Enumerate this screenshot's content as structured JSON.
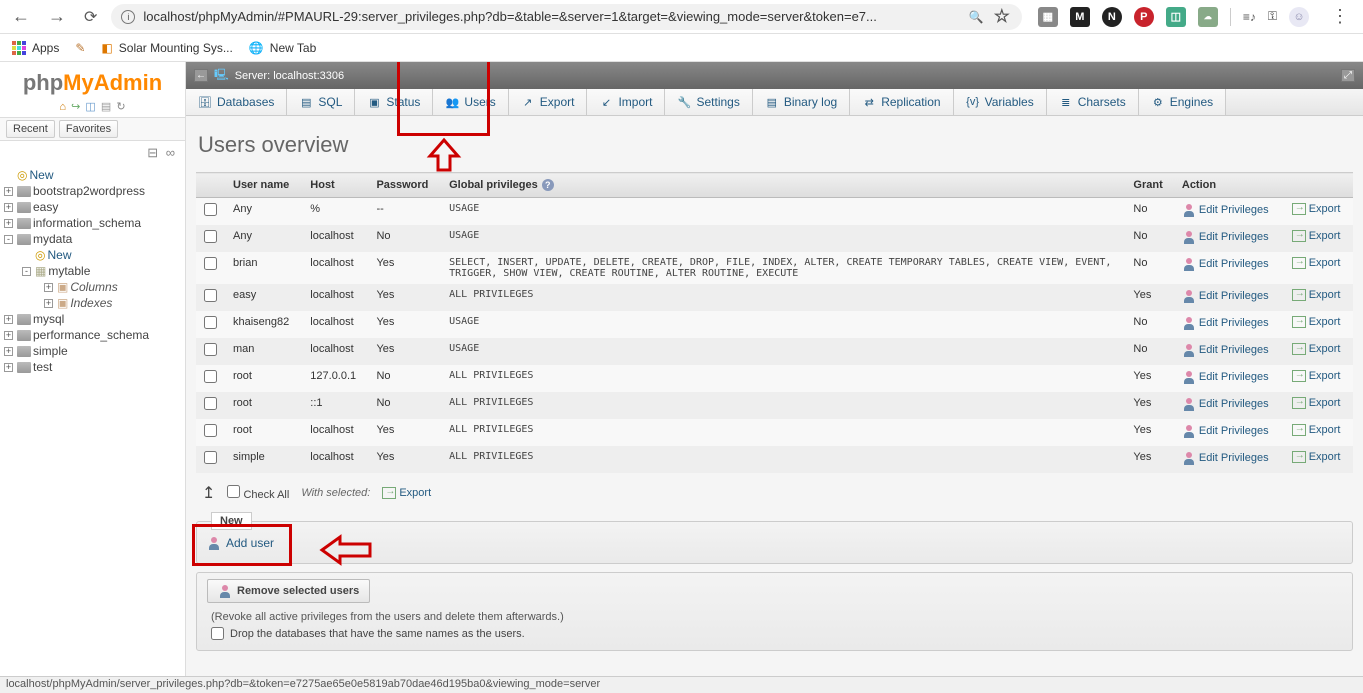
{
  "browser": {
    "url": "localhost/phpMyAdmin/#PMAURL-29:server_privileges.php?db=&table=&server=1&target=&viewing_mode=server&token=e7...",
    "bookmarks": {
      "apps": "Apps",
      "solar": "Solar Mounting Sys...",
      "newtab": "New Tab"
    }
  },
  "logo": {
    "php": "php",
    "my": "My",
    "admin": "Admin"
  },
  "sidebar": {
    "recent": "Recent",
    "favorites": "Favorites",
    "tree": [
      {
        "label": "New",
        "type": "new",
        "depth": 0
      },
      {
        "label": "bootstrap2wordpress",
        "type": "db",
        "depth": 0,
        "exp": "+"
      },
      {
        "label": "easy",
        "type": "db",
        "depth": 0,
        "exp": "+"
      },
      {
        "label": "information_schema",
        "type": "db",
        "depth": 0,
        "exp": "+"
      },
      {
        "label": "mydata",
        "type": "db",
        "depth": 0,
        "exp": "-"
      },
      {
        "label": "New",
        "type": "new",
        "depth": 1
      },
      {
        "label": "mytable",
        "type": "table",
        "depth": 1,
        "exp": "-"
      },
      {
        "label": "Columns",
        "type": "cols",
        "depth": 2,
        "exp": "+",
        "italic": true
      },
      {
        "label": "Indexes",
        "type": "idx",
        "depth": 2,
        "exp": "+",
        "italic": true
      },
      {
        "label": "mysql",
        "type": "db",
        "depth": 0,
        "exp": "+"
      },
      {
        "label": "performance_schema",
        "type": "db",
        "depth": 0,
        "exp": "+"
      },
      {
        "label": "simple",
        "type": "db",
        "depth": 0,
        "exp": "+"
      },
      {
        "label": "test",
        "type": "db",
        "depth": 0,
        "exp": "+"
      }
    ]
  },
  "server_bar": "Server: localhost:3306",
  "tabs": [
    {
      "label": "Databases",
      "icon": "🗄"
    },
    {
      "label": "SQL",
      "icon": "▤"
    },
    {
      "label": "Status",
      "icon": "▣"
    },
    {
      "label": "Users",
      "icon": "👥"
    },
    {
      "label": "Export",
      "icon": "↗"
    },
    {
      "label": "Import",
      "icon": "↙"
    },
    {
      "label": "Settings",
      "icon": "🔧"
    },
    {
      "label": "Binary log",
      "icon": "▤"
    },
    {
      "label": "Replication",
      "icon": "⇄"
    },
    {
      "label": "Variables",
      "icon": "{v}"
    },
    {
      "label": "Charsets",
      "icon": "≣"
    },
    {
      "label": "Engines",
      "icon": "⚙"
    }
  ],
  "page_title": "Users overview",
  "headers": {
    "user": "User name",
    "host": "Host",
    "password": "Password",
    "globalpriv": "Global privileges",
    "grant": "Grant",
    "action": "Action"
  },
  "edit_label": "Edit Privileges",
  "export_label": "Export",
  "users": [
    {
      "user": "Any",
      "user_red": true,
      "host": "%",
      "password": "--",
      "priv": "USAGE",
      "grant": "No"
    },
    {
      "user": "Any",
      "user_red": true,
      "host": "localhost",
      "password": "No",
      "pw_red": true,
      "priv": "USAGE",
      "grant": "No"
    },
    {
      "user": "brian",
      "host": "localhost",
      "password": "Yes",
      "priv": "SELECT, INSERT, UPDATE, DELETE, CREATE, DROP, FILE, INDEX, ALTER, CREATE TEMPORARY TABLES, CREATE VIEW, EVENT, TRIGGER, SHOW VIEW, CREATE ROUTINE, ALTER ROUTINE, EXECUTE",
      "grant": "No"
    },
    {
      "user": "easy",
      "host": "localhost",
      "password": "Yes",
      "priv": "ALL PRIVILEGES",
      "grant": "Yes"
    },
    {
      "user": "khaiseng82",
      "host": "localhost",
      "password": "Yes",
      "priv": "USAGE",
      "grant": "No"
    },
    {
      "user": "man",
      "host": "localhost",
      "password": "Yes",
      "priv": "USAGE",
      "grant": "No"
    },
    {
      "user": "root",
      "host": "127.0.0.1",
      "password": "No",
      "pw_red": true,
      "priv": "ALL PRIVILEGES",
      "grant": "Yes"
    },
    {
      "user": "root",
      "host": "::1",
      "password": "No",
      "pw_red": true,
      "priv": "ALL PRIVILEGES",
      "grant": "Yes"
    },
    {
      "user": "root",
      "host": "localhost",
      "password": "Yes",
      "priv": "ALL PRIVILEGES",
      "grant": "Yes"
    },
    {
      "user": "simple",
      "host": "localhost",
      "password": "Yes",
      "priv": "ALL PRIVILEGES",
      "grant": "Yes"
    }
  ],
  "checkall": "Check All",
  "with_selected": "With selected:",
  "export_sel": "Export",
  "new_legend": "New",
  "add_user": "Add user",
  "remove_legend": "Remove selected users",
  "revoke_text": "(Revoke all active privileges from the users and delete them afterwards.)",
  "drop_text": "Drop the databases that have the same names as the users.",
  "status_url": "localhost/phpMyAdmin/server_privileges.php?db=&token=e7275ae65e0e5819ab70dae46d195ba0&viewing_mode=server"
}
